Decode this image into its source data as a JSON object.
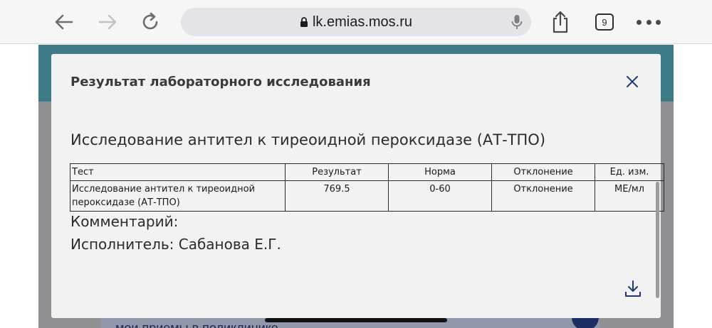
{
  "browser": {
    "url": "lk.emias.mos.ru",
    "tab_count": "9",
    "icons": {
      "back": "back-arrow-icon",
      "forward": "forward-arrow-icon",
      "reload": "reload-icon",
      "lock": "lock-icon",
      "mic": "microphone-icon",
      "share": "share-icon",
      "more": "more-dots-icon"
    }
  },
  "background_page": {
    "link_text": "мои приемы в поликлинике"
  },
  "modal": {
    "title": "Результат лабораторного исследования",
    "close_icon": "close-icon",
    "study_title": "Исследование антител к тиреоидной пероксидазе (АТ-ТПО)",
    "table": {
      "headers": [
        "Тест",
        "Результат",
        "Норма",
        "Отклонение",
        "Ед. изм."
      ],
      "rows": [
        [
          "Исследование антител к тиреоидной пероксидазе (АТ-ТПО)",
          "769.5",
          "0-60",
          "Отклонение",
          "МЕ/мл"
        ]
      ]
    },
    "comment_label": "Комментарий:",
    "executor": "Исполнитель: Сабанова Е.Г.",
    "download_icon": "download-icon"
  },
  "colors": {
    "accent_teal": "#3d7c86",
    "link_navy": "#1d2a55",
    "icon_navy": "#1d2e63"
  }
}
